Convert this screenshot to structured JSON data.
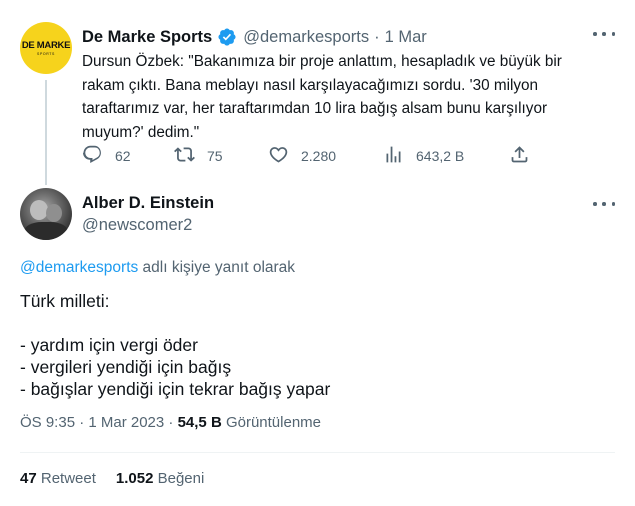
{
  "parent_tweet": {
    "avatar_logo_text": "DE MARKE",
    "avatar_logo_subtext": "SPORTS",
    "display_name": "De Marke Sports",
    "handle": "@demarkesports",
    "separator": "·",
    "date": "1 Mar",
    "text": "Dursun Özbek: \"Bakanımıza bir proje anlattım, hesapladık ve büyük bir rakam çıktı. Bana meblayı nasıl karşılayacağımızı sordu. '30 milyon taraftarımız var, her taraftarımdan 10 lira bağış alsam bunu karşılıyor muyum?' dedim.\"",
    "actions": {
      "replies": "62",
      "retweets": "75",
      "likes": "2.280",
      "views": "643,2 B"
    }
  },
  "main_tweet": {
    "display_name": "Alber D. Einstein",
    "handle": "@newscomer2",
    "reply_mention": "@demarkesports",
    "reply_suffix": " adlı kişiye yanıt olarak",
    "body": {
      "line1": "Türk milleti:",
      "line2": "- yardım için vergi öder",
      "line3": "- vergileri yendiği için bağış",
      "line4": "- bağışlar yendiği için tekrar bağış yapar"
    },
    "meta": {
      "time_date": "ÖS 9:35 · 1 Mar 2023 · ",
      "views_count": "54,5 B",
      "views_label": " Görüntülenme"
    },
    "stats": {
      "retweets_count": "47",
      "retweets_label": " Retweet",
      "likes_count": "1.052",
      "likes_label": " Beğeni"
    }
  },
  "colors": {
    "text_primary": "#0f1419",
    "text_secondary": "#536471",
    "accent": "#1d9bf0",
    "brand_yellow": "#f6d31c",
    "thread_line": "#cfd9de"
  },
  "icons": {
    "verified": "verified-badge-icon",
    "more": "more-horizontal-icon",
    "reply": "reply-icon",
    "retweet": "retweet-icon",
    "like": "heart-icon",
    "views": "views-chart-icon",
    "share": "share-icon"
  }
}
